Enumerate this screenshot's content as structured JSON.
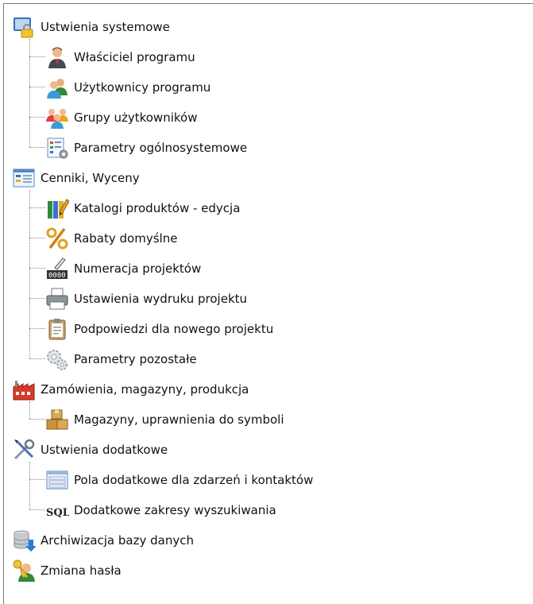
{
  "tree": {
    "groups": [
      {
        "label": "Ustwienia systemowe",
        "icon": "system-settings-lock-icon",
        "children": [
          {
            "label": "Właściciel programu",
            "icon": "owner-person-icon"
          },
          {
            "label": "Użytkownicy programu",
            "icon": "users-icon"
          },
          {
            "label": "Grupy użytkowników",
            "icon": "user-groups-icon"
          },
          {
            "label": "Parametry ogólnosystemowe",
            "icon": "system-parameters-icon"
          }
        ]
      },
      {
        "label": "Cenniki, Wyceny",
        "icon": "price-list-icon",
        "children": [
          {
            "label": "Katalogi produktów - edycja",
            "icon": "catalog-edit-icon"
          },
          {
            "label": "Rabaty domyślne",
            "icon": "percent-icon"
          },
          {
            "label": "Numeracja projektów",
            "icon": "numbering-counter-icon"
          },
          {
            "label": "Ustawienia wydruku projektu",
            "icon": "printer-icon"
          },
          {
            "label": "Podpowiedzi dla nowego projektu",
            "icon": "clipboard-icon"
          },
          {
            "label": "Parametry pozostałe",
            "icon": "gears-icon"
          }
        ]
      },
      {
        "label": "Zamówienia, magazyny, produkcja",
        "icon": "factory-icon",
        "children": [
          {
            "label": "Magazyny, uprawnienia do symboli",
            "icon": "warehouse-boxes-icon"
          }
        ]
      },
      {
        "label": "Ustwienia dodatkowe",
        "icon": "tools-icon",
        "children": [
          {
            "label": "Pola dodatkowe dla zdarzeń i kontaktów",
            "icon": "form-fields-icon"
          },
          {
            "label": "Dodatkowe zakresy wyszukiwania",
            "icon": "sql-icon"
          }
        ]
      },
      {
        "label": "Archiwizacja bazy danych",
        "icon": "database-archive-icon",
        "children": []
      },
      {
        "label": "Zmiana hasła",
        "icon": "change-password-key-icon",
        "children": []
      }
    ]
  }
}
